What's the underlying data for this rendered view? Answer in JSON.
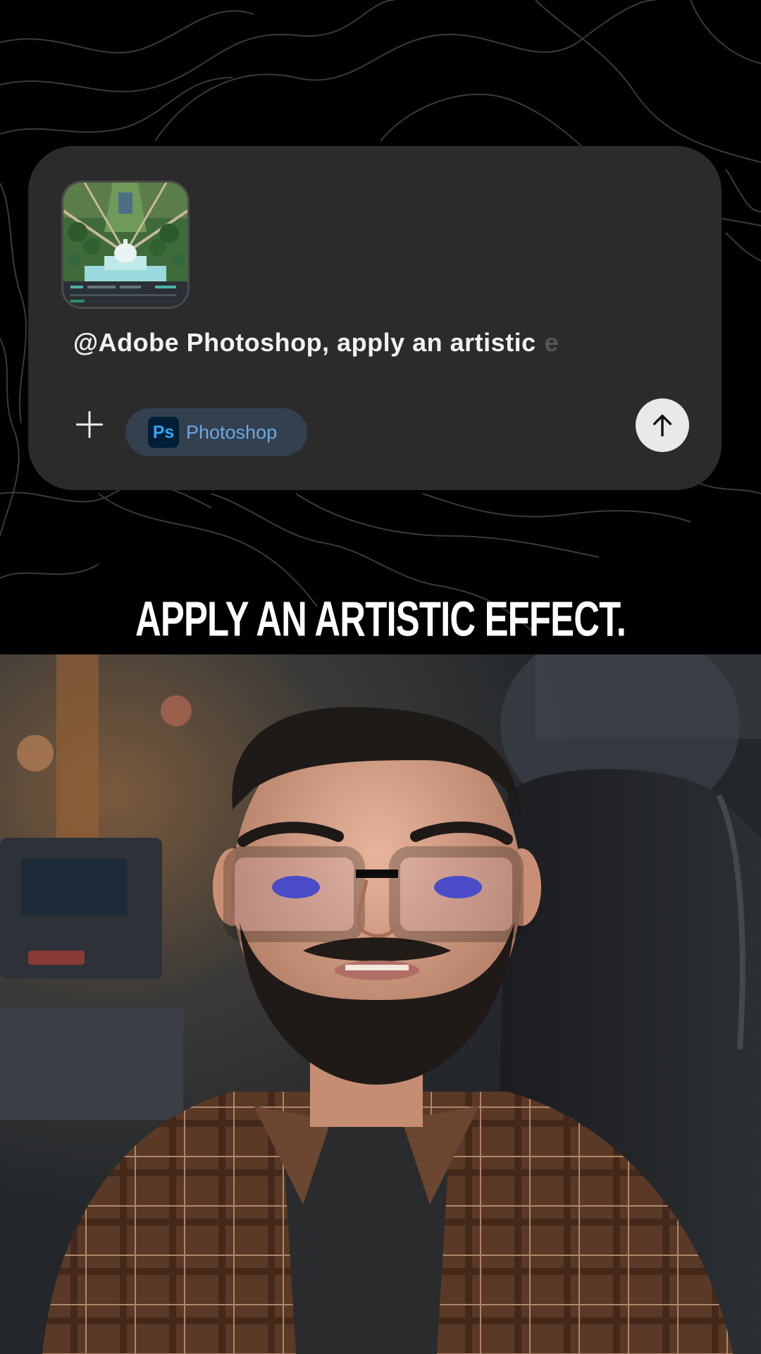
{
  "prompt_card": {
    "attachment_icon": "image-thumbnail-icon",
    "typed_text": "@Adobe Photoshop, apply an artistic",
    "ghost_text": "e",
    "add_icon": "plus-icon",
    "app_chip": {
      "badge": "Ps",
      "label": "Photoshop"
    },
    "send_icon": "arrow-up-icon"
  },
  "caption": "APPLY AN ARTISTIC EFFECT.",
  "colors": {
    "background": "#000000",
    "card": "#2b2b2b",
    "chip": "#34404e",
    "chip_text": "#6aa9e6",
    "ps_badge_bg": "#001e36",
    "ps_badge_text": "#31a8ff",
    "send_button": "#e9e9e9"
  }
}
